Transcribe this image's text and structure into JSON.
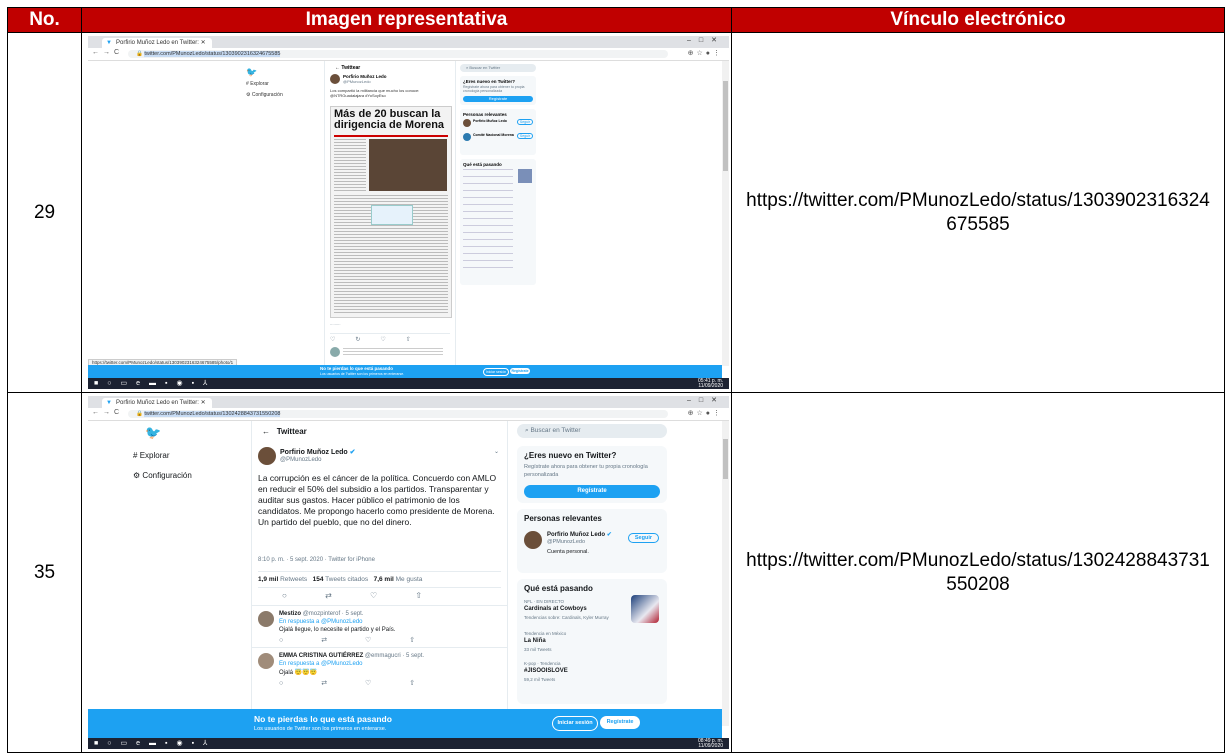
{
  "table": {
    "headers": {
      "no": "No.",
      "image": "Imagen representativa",
      "link": "Vínculo electrónico"
    },
    "rows": [
      {
        "no": "29",
        "link": "https://twitter.com/PMunozLedo/status/1303902316324675585"
      },
      {
        "no": "35",
        "link": "https://twitter.com/PMunozLedo/status/1302428843731550208"
      }
    ]
  },
  "shot1": {
    "tab_title": "Porfirio Muñoz Ledo en Twitter:",
    "url": "twitter.com/PMunozLedo/status/1303902316324675585",
    "status_url": "https://twitter.com/PMunozLedo/status/1303902316324675585/photo/1",
    "header": "Twittear",
    "search": "Buscar en Twitter",
    "nav_explore": "Explorar",
    "nav_settings": "Configuración",
    "author": "Porfirio Muñoz Ledo",
    "handle": "@PMunozLedo",
    "tweet_text": "Los compartió la militancia que mucho los conoce: @NTRGuadalajara #YoSoyEso",
    "headline": "Más de 20 buscan la dirigencia de Morena",
    "new_title": "¿Eres nuevo en Twitter?",
    "new_desc": "Regístrate ahora para obtener tu propia cronología personalizada",
    "register": "Regístrate",
    "persons_title": "Personas relevantes",
    "follow": "Seguir",
    "person2": "Comité Nacional Morena",
    "trends_title": "Qué está pasando",
    "banner_title": "No te pierdas lo que está pasando",
    "banner_sub": "Los usuarios de Twitter son los primeros en enterarse.",
    "login": "Iniciar sesión",
    "time": "05:41 p. m.",
    "date": "11/09/2020"
  },
  "shot2": {
    "tab_title": "Porfirio Muñoz Ledo en Twitter:",
    "url": "twitter.com/PMunozLedo/status/1302428843731550208",
    "header": "Twittear",
    "search": "Buscar en Twitter",
    "nav_explore": "Explorar",
    "nav_settings": "Configuración",
    "author": "Porfirio Muñoz Ledo",
    "handle": "@PMunozLedo",
    "tweet_text": "La corrupción es el cáncer de la política. Concuerdo con AMLO en reducir el 50% del subsidio a los partidos. Transparentar y auditar sus gastos. Hacer público el patrimonio de los candidatos. Me propongo hacerlo como presidente de Morena. Un partido del pueblo, que no del dinero.",
    "tweet_meta": "8:10 p. m. · 5 sept. 2020 · Twitter for iPhone",
    "stats": {
      "retweets_n": "1,9 mil",
      "retweets_l": "Retweets",
      "quotes_n": "154",
      "quotes_l": "Tweets citados",
      "likes_n": "7,6 mil",
      "likes_l": "Me gusta"
    },
    "reply1_name": "Mestizo",
    "reply1_meta": "@mozpinterof · 5 sept.",
    "reply1_to": "En respuesta a @PMunozLedo",
    "reply1_text": "Ojalá llegue, lo necesite el partido y el País.",
    "reply2_name": "EMMA CRISTINA GUTIÉRREZ",
    "reply2_meta": "@emmagucri · 5 sept.",
    "reply2_to": "En respuesta a @PMunozLedo",
    "reply2_text": "Ojalá 😇😇😇",
    "new_title": "¿Eres nuevo en Twitter?",
    "new_desc": "Regístrate ahora para obtener tu propia cronología personalizada",
    "register": "Regístrate",
    "persons_title": "Personas relevantes",
    "person_name": "Porfirio Muñoz Ledo",
    "person_handle": "@PMunozLedo",
    "person_desc": "Cuenta personal.",
    "follow": "Seguir",
    "trends_title": "Qué está pasando",
    "trend1_cat": "NFL · EN DIRECTO",
    "trend1_name": "Cardinals at Cowboys",
    "trend1_sub": "Tendencias sobre: Cardinals, Kyler Murray",
    "trend2_cat": "Tendencia en México",
    "trend2_name": "La Niña",
    "trend2_count": "33 mil Tweets",
    "trend3_cat": "K-pop · Tendencia",
    "trend3_name": "#JISOOISLOVE",
    "trend3_count": "59,2 mil Tweets",
    "banner_title": "No te pierdas lo que está pasando",
    "banner_sub": "Los usuarios de Twitter son los primeros en enterarse.",
    "login": "Iniciar sesión",
    "time": "08:49 p. m.",
    "date": "11/09/2020"
  }
}
